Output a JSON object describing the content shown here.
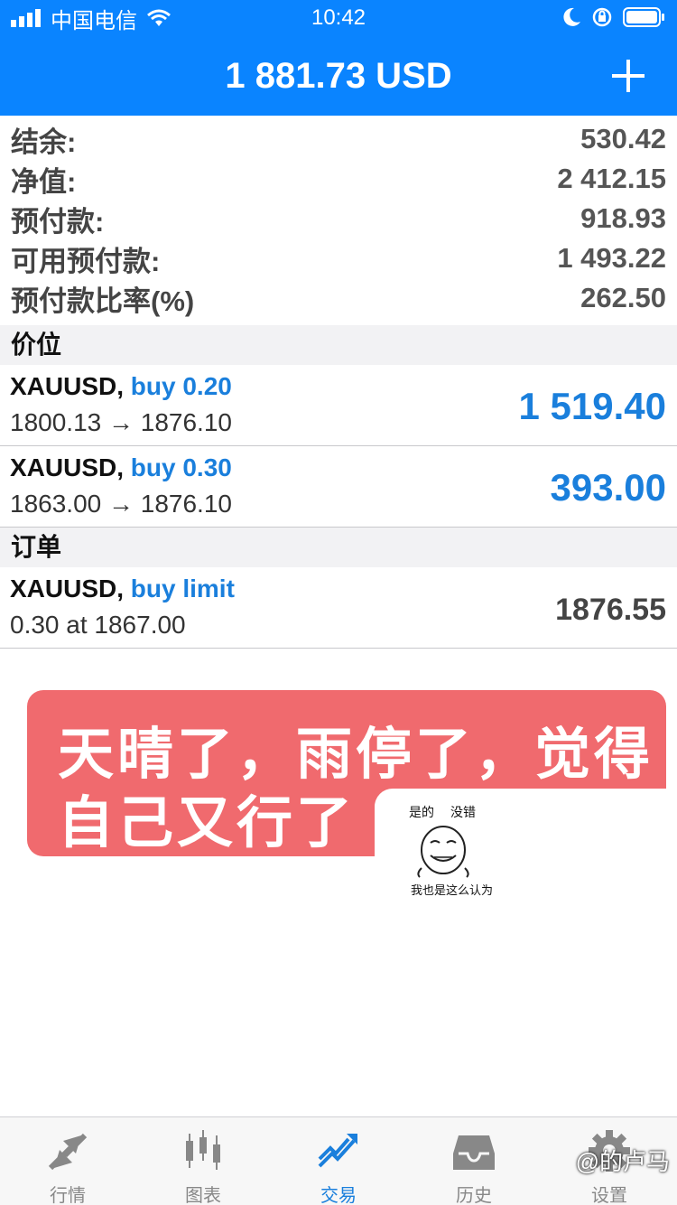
{
  "status_bar": {
    "carrier": "中国电信",
    "time": "10:42"
  },
  "header": {
    "balance_title": "1 881.73 USD"
  },
  "summary": [
    {
      "label": "结余:",
      "value": "530.42"
    },
    {
      "label": "净值:",
      "value": "2 412.15"
    },
    {
      "label": "预付款:",
      "value": "918.93"
    },
    {
      "label": "可用预付款:",
      "value": "1 493.22"
    },
    {
      "label": "预付款比率(%)",
      "value": "262.50"
    }
  ],
  "positions": {
    "title": "价位",
    "items": [
      {
        "symbol": "XAUUSD,",
        "side": "buy 0.20",
        "prices": "1800.13 → 1876.10",
        "profit": "1 519.40"
      },
      {
        "symbol": "XAUUSD,",
        "side": "buy 0.30",
        "prices": "1863.00 → 1876.10",
        "profit": "393.00"
      }
    ]
  },
  "orders": {
    "title": "订单",
    "items": [
      {
        "symbol": "XAUUSD,",
        "side": "buy limit",
        "details": "0.30 at 1867.00",
        "price": "1876.55"
      }
    ]
  },
  "overlay": {
    "line1": "天晴了，雨停了，觉得",
    "line2": "自己又行了",
    "meme_top_left": "是的",
    "meme_top_right": "没错",
    "meme_bottom": "我也是这么认为",
    "bubble_color": "#f06a6e"
  },
  "tabs": [
    {
      "label": "行情",
      "icon": "quotes-arrows-icon"
    },
    {
      "label": "图表",
      "icon": "candlestick-chart-icon"
    },
    {
      "label": "交易",
      "icon": "trade-trend-icon",
      "active": true
    },
    {
      "label": "历史",
      "icon": "history-tray-icon"
    },
    {
      "label": "设置",
      "icon": "gear-icon"
    }
  ],
  "watermark": "@的卢马",
  "colors": {
    "accent": "#0a84ff",
    "link_blue": "#1a7fdc"
  }
}
